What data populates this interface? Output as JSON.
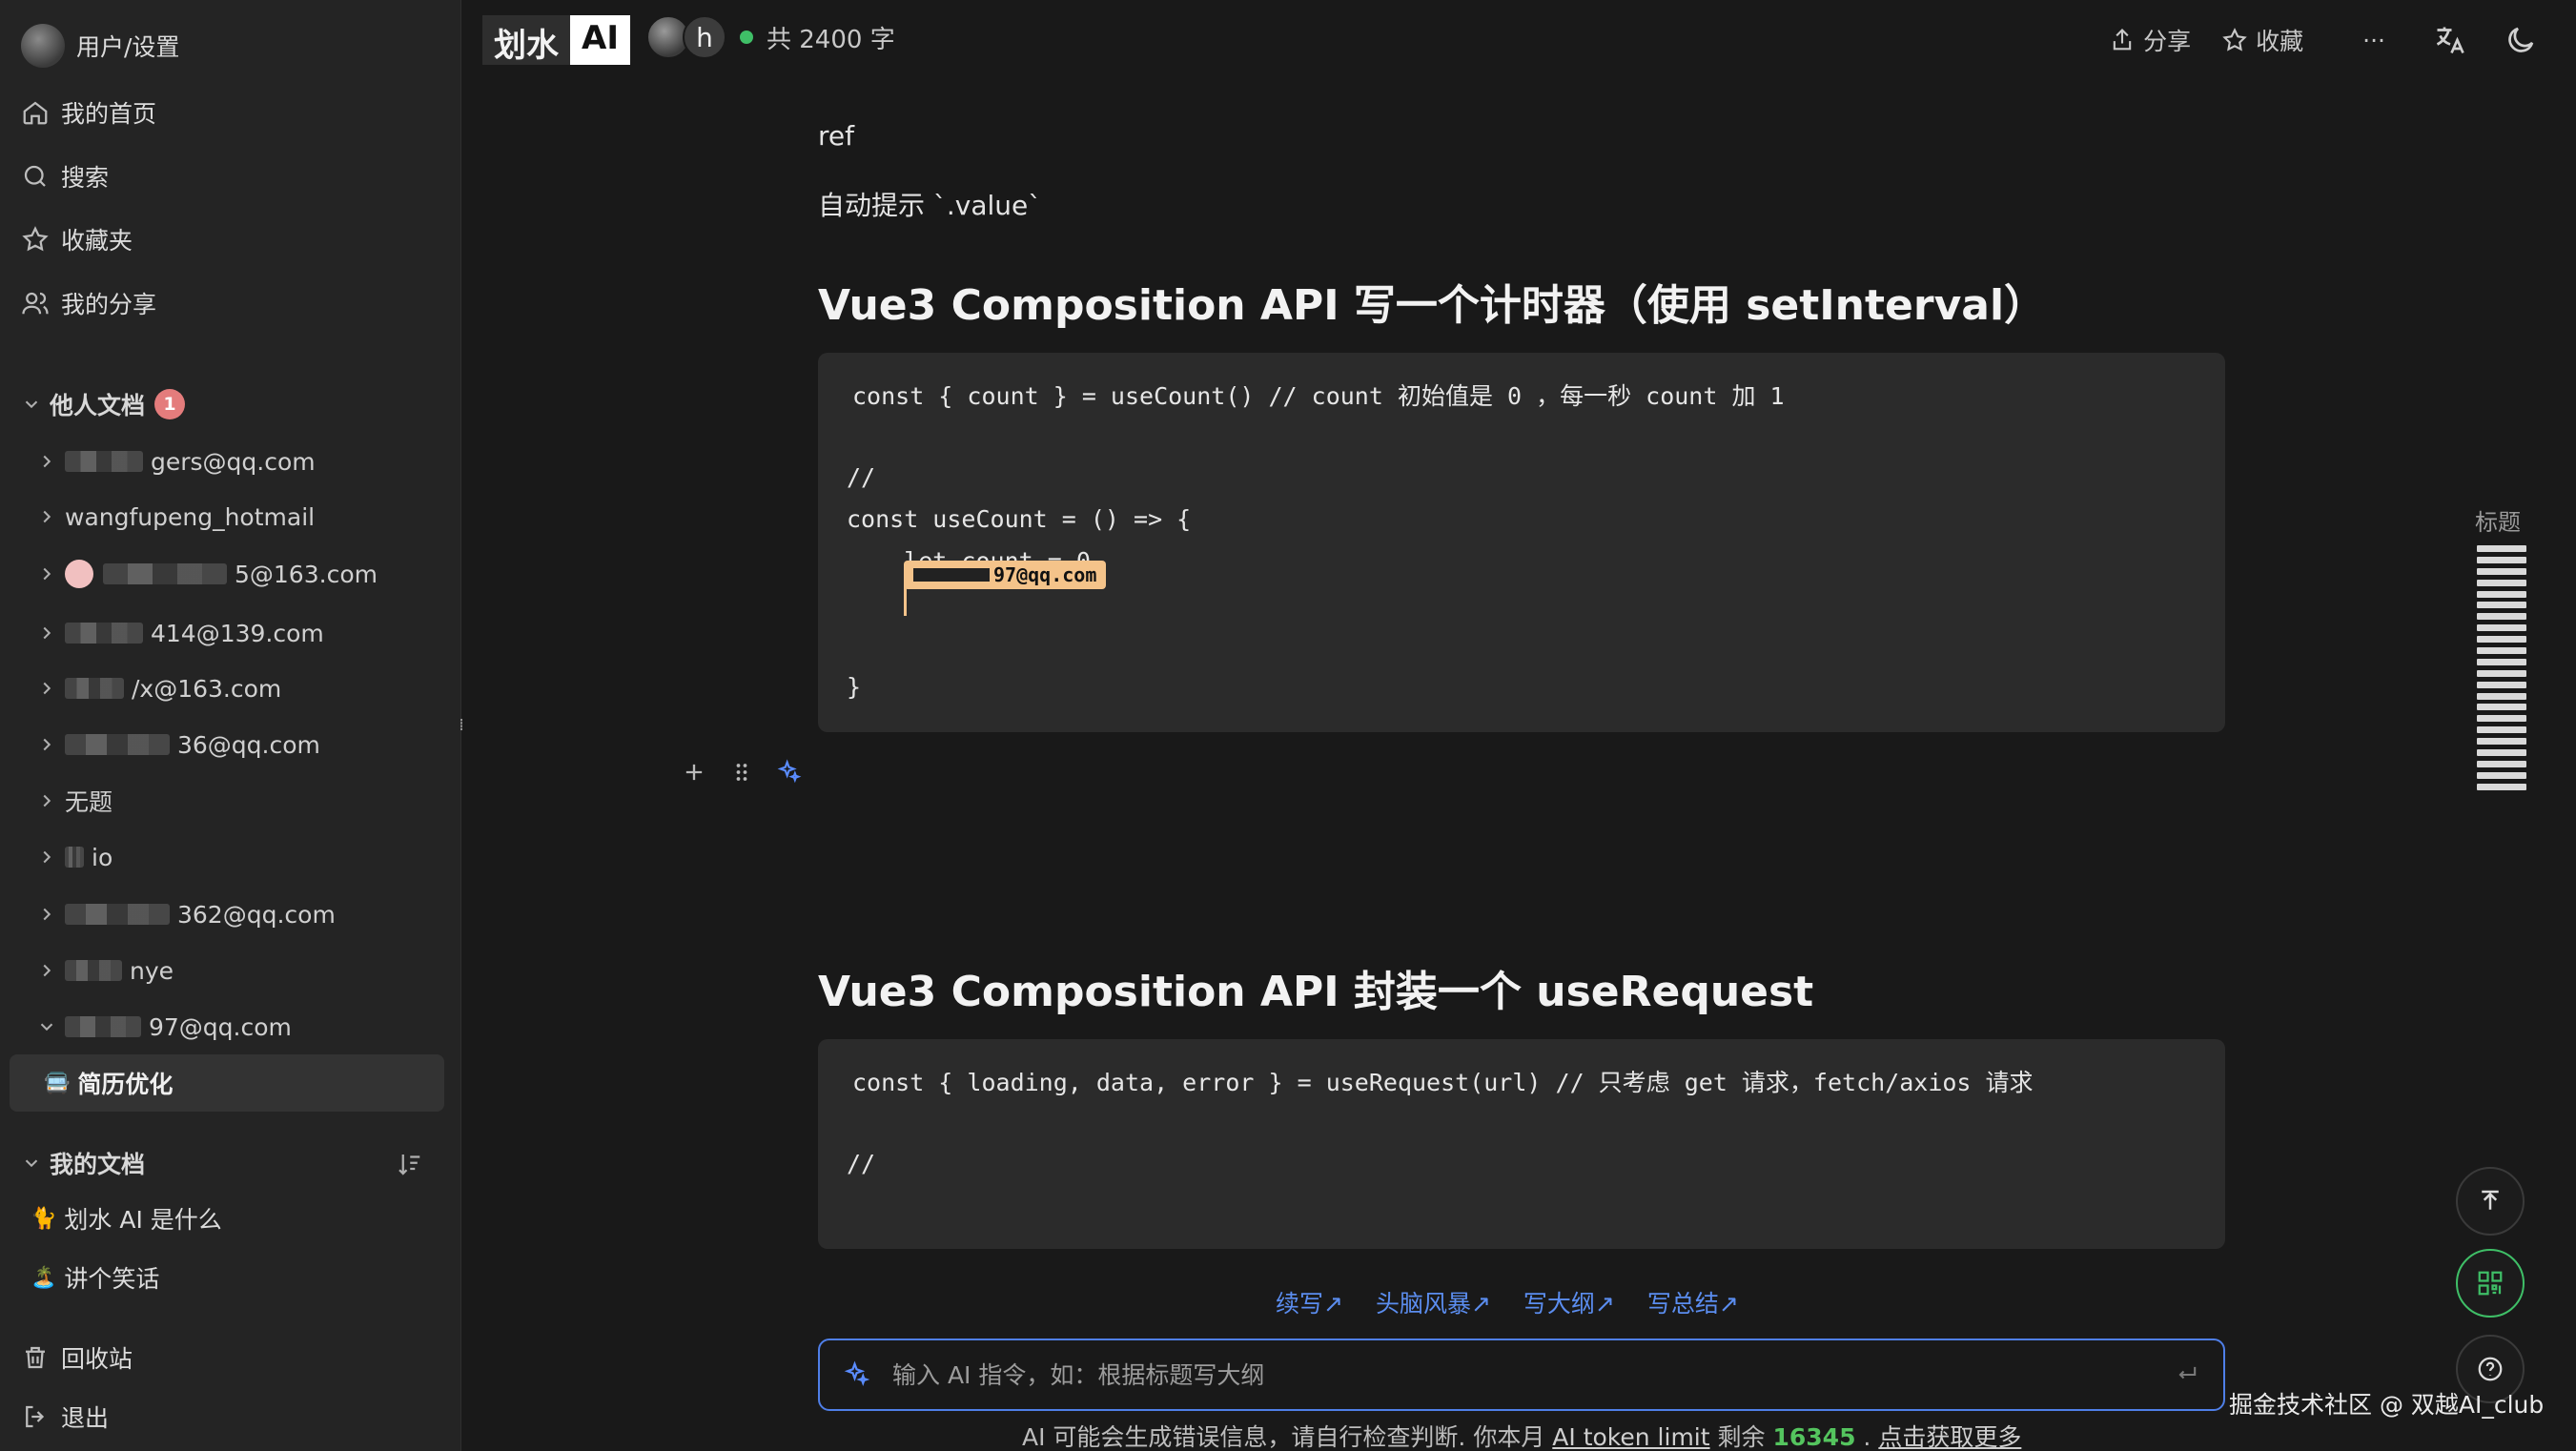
{
  "sidebar": {
    "user_settings": "用户/设置",
    "nav": [
      {
        "label": "我的首页",
        "icon": "home-icon"
      },
      {
        "label": "搜索",
        "icon": "search-icon"
      },
      {
        "label": "收藏夹",
        "icon": "star-icon"
      },
      {
        "label": "我的分享",
        "icon": "users-icon"
      }
    ],
    "others_docs": {
      "title": "他人文档",
      "badge": "1"
    },
    "others_items": [
      {
        "label": "gers@qq.com",
        "masked": true
      },
      {
        "label": "wangfupeng_hotmail",
        "masked": false
      },
      {
        "label": "5@163.com",
        "masked": true,
        "dot": true
      },
      {
        "label": "414@139.com",
        "masked": true
      },
      {
        "label": "/x@163.com",
        "masked": true
      },
      {
        "label": "36@qq.com",
        "masked": true
      },
      {
        "label": "无题",
        "masked": false
      },
      {
        "label": "io",
        "masked": true
      },
      {
        "label": "362@qq.com",
        "masked": true
      },
      {
        "label": "nye",
        "masked": true
      },
      {
        "label": "97@qq.com",
        "masked": true,
        "expanded": true
      }
    ],
    "active_doc": {
      "emoji": "🚍",
      "label": "简历优化"
    },
    "my_docs": {
      "title": "我的文档",
      "items": [
        {
          "emoji": "🐈",
          "label": "划水 AI 是什么"
        },
        {
          "emoji": "🏝️",
          "label": "讲个笑话"
        }
      ]
    },
    "trash": "回收站",
    "logout": "退出"
  },
  "header": {
    "logo_part1": "划水",
    "logo_part2": "AI",
    "collaborator_initial": "h",
    "word_count": "共 2400 字",
    "share": "分享",
    "favorite": "收藏",
    "more": "···"
  },
  "doc": {
    "p1": "ref",
    "p2": "自动提示 `.value`",
    "h1": "Vue3 Composition API 写一个计时器（使用 setInterval）",
    "code1": [
      "const { count } = useCount() // count 初始值是 0 ，每一秒 count 加 1",
      "",
      "//",
      "const useCount = () => {",
      "    let count = 0",
      "",
      "",
      "}"
    ],
    "cursor_user": "97@qq.com",
    "h2": "Vue3 Composition API 封装一个 useRequest",
    "code2": [
      "const { loading, data, error } = useRequest(url) // 只考虑 get 请求，fetch/axios 请求",
      "",
      "//"
    ]
  },
  "ai": {
    "suggestions": [
      "续写↗",
      "头脑风暴↗",
      "写大纲↗",
      "写总结↗"
    ],
    "input_placeholder": "输入 AI 指令，如：根据标题写大纲",
    "disclaimer_prefix": "AI 可能会生成错误信息，请自行检查判断. 你本月",
    "token_link": "AI token limit",
    "remaining_label": "剩余",
    "remaining": "16345",
    "sep": ".",
    "get_more": "点击获取更多"
  },
  "toc": {
    "label": "标题",
    "bar_count": 22
  },
  "watermark": "掘金技术社区 @ 双越AI_club",
  "colors": {
    "background": "#191919",
    "sidebar": "#242424",
    "accent_blue": "#4f7fe8",
    "accent_green": "#3fbf67",
    "cursor_tag": "#f4c38a",
    "badge": "#e47c7c"
  }
}
